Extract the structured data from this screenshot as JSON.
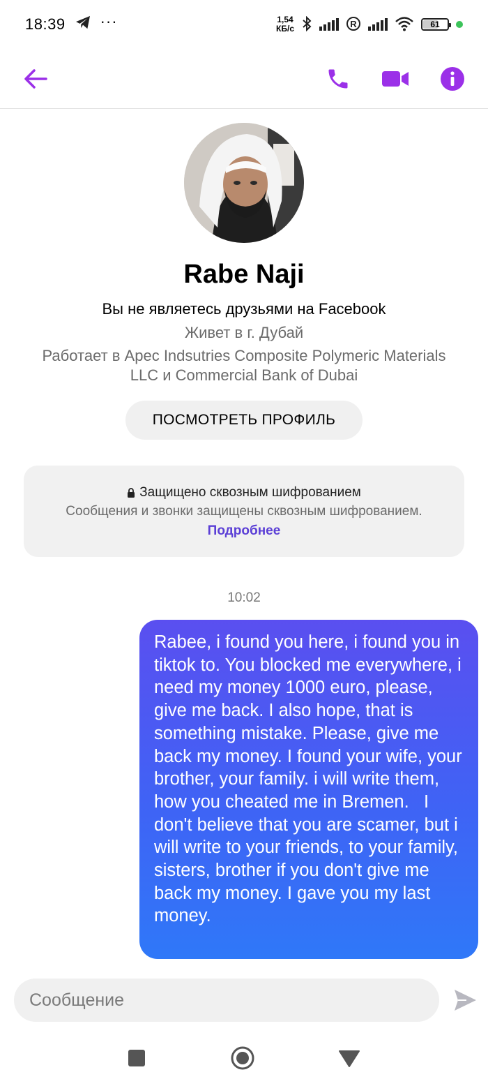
{
  "status_bar": {
    "time": "18:39",
    "extra_dots": "···",
    "net_speed_value": "1,54",
    "net_speed_unit": "КБ/с",
    "battery": "61",
    "battery_level": 0.61
  },
  "header": {
    "accent_color": "#9b30e8"
  },
  "profile": {
    "name": "Rabe Naji",
    "friend_status": "Вы не являетесь друзьями на Facebook",
    "lives_in": "Живет в г. Дубай",
    "works_at": "Работает в Apec Indsutries Composite Polymeric Materials LLC и Commercial Bank of Dubai",
    "view_profile_label": "ПОСМОТРЕТЬ ПРОФИЛЬ"
  },
  "encryption": {
    "title": "Защищено сквозным шифрованием",
    "text": "Сообщения и звонки защищены сквозным шифрованием.",
    "link": "Подробнее"
  },
  "conversation": {
    "timestamp": "10:02",
    "messages": [
      {
        "sender": "me",
        "text": "Rabee, i found you here, i found you in tiktok to. You blocked me everywhere, i need my money 1000 euro, please, give me back. I also hope, that is something mistake. Please, give me back my money. I found your wife, your brother, your family. i will write them, how you cheated me in Bremen.   I don't believe that you are scamer, but i will write to your friends, to your family, sisters, brother if you don't give me back my money. I gave you my last money."
      }
    ]
  },
  "composer": {
    "placeholder": "Сообщение"
  }
}
